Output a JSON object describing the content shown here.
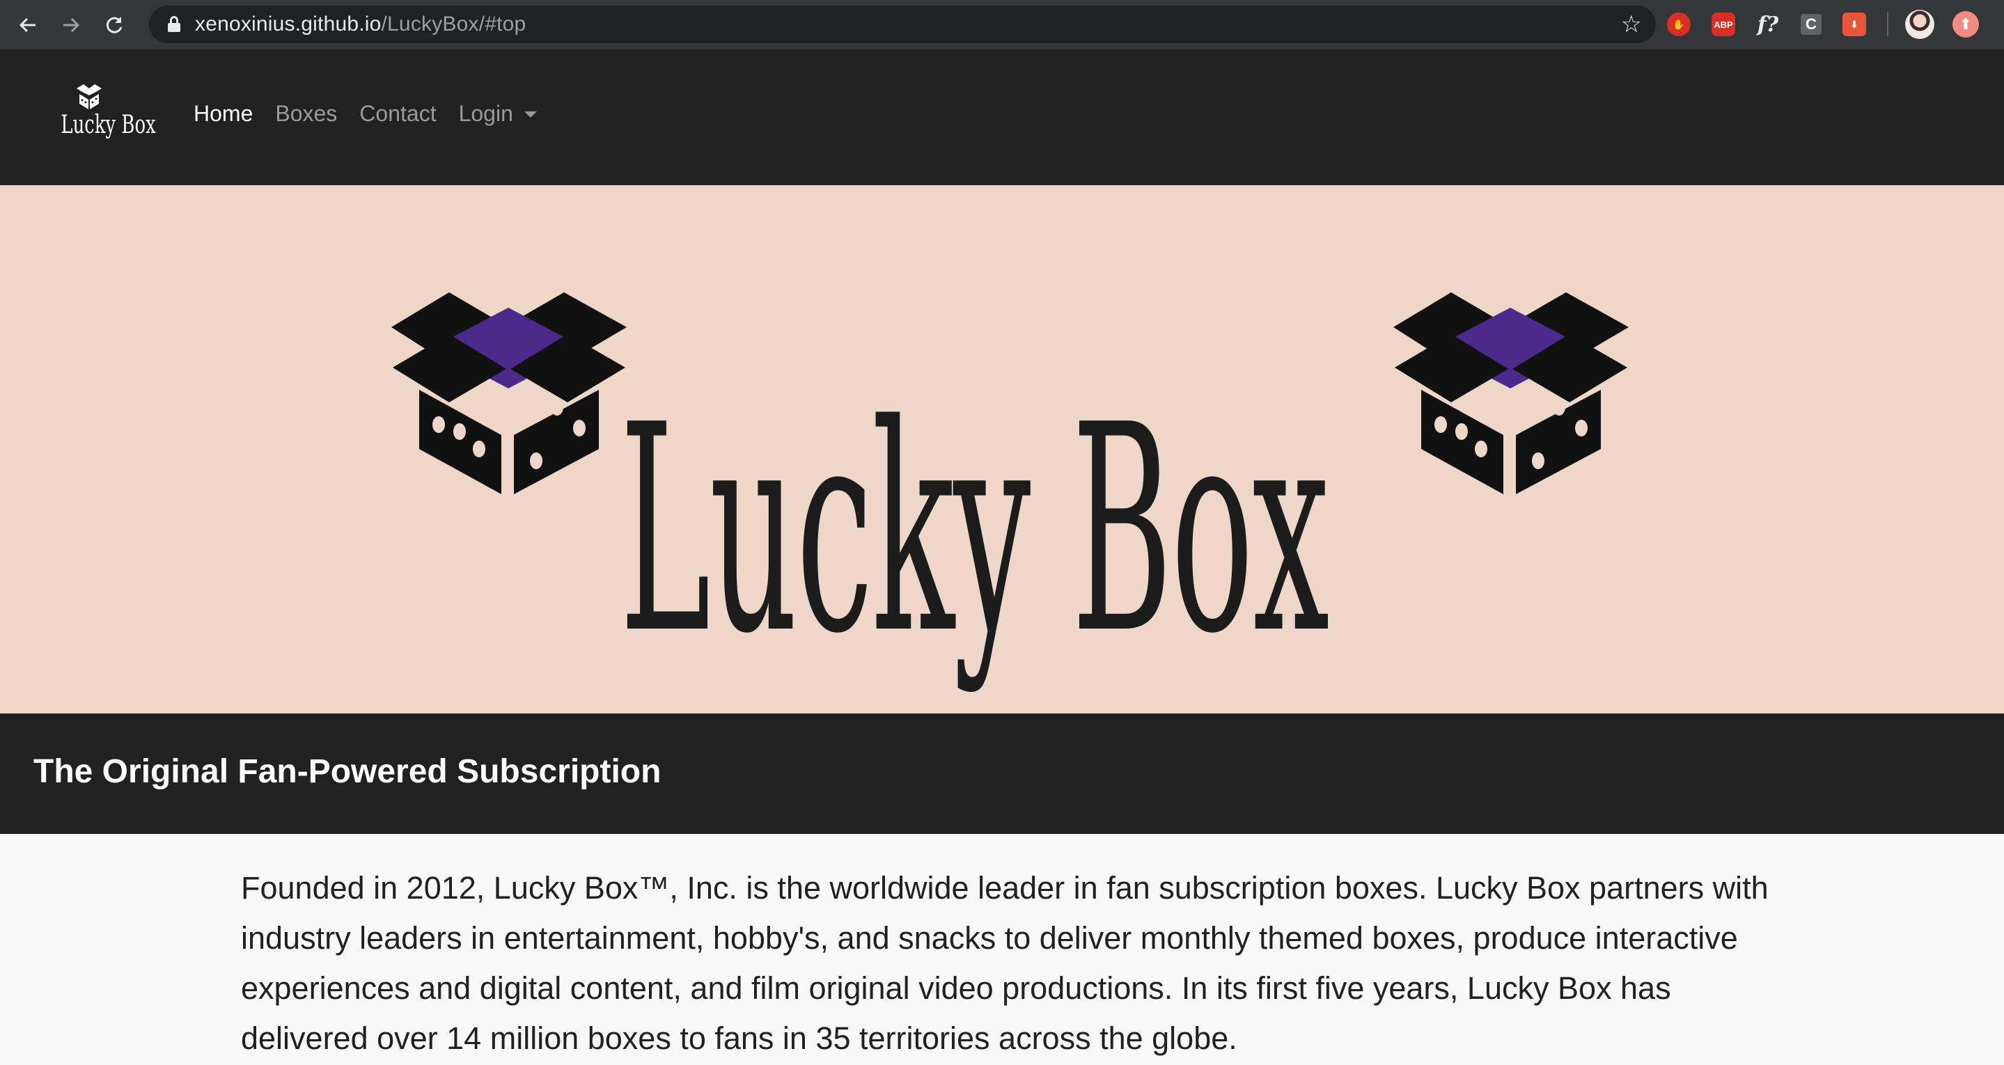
{
  "browser": {
    "url_host": "xenoxinius.github.io",
    "url_path": "/LuckyBox/#top",
    "extensions": {
      "abp_label": "ABP",
      "font_label": "f?",
      "c_label": "C"
    }
  },
  "navbar": {
    "logo_text": "Lucky Box",
    "links": [
      {
        "label": "Home"
      },
      {
        "label": "Boxes"
      },
      {
        "label": "Contact"
      },
      {
        "label": "Login"
      }
    ]
  },
  "hero": {
    "title": "Lucky Box"
  },
  "tagline": {
    "text": "The Original Fan-Powered Subscription"
  },
  "about": {
    "text": "Founded in 2012, Lucky Box™, Inc. is the worldwide leader in fan subscription boxes. Lucky Box partners with industry leaders in entertainment, hobby's, and snacks to deliver monthly themed boxes, produce interactive experiences and digital content, and film original video productions. In its first five years, Lucky Box has delivered over 14 million boxes to fans in 35 territories across the globe."
  },
  "colors": {
    "navbar_bg": "#212121",
    "hero_bg": "#eed7c8",
    "box_inner": "#4b2a8c",
    "box_dark": "#111111",
    "page_bg": "#f8f8f8"
  },
  "icons": {
    "back": "arrow-left-icon",
    "forward": "arrow-right-icon",
    "reload": "reload-icon",
    "lock": "lock-icon",
    "bookmark": "star-icon"
  }
}
